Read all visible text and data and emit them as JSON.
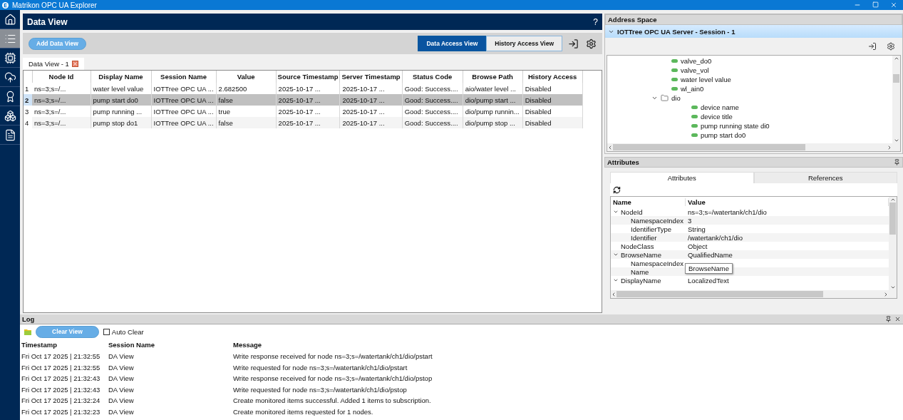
{
  "window": {
    "title": "Matrikon OPC UA Explorer"
  },
  "sidebar": {
    "items": [
      {
        "kind": "home",
        "selected": false
      },
      {
        "kind": "list",
        "selected": true
      },
      {
        "kind": "chip",
        "selected": false
      },
      {
        "kind": "cloud",
        "selected": false
      },
      {
        "kind": "certificate",
        "selected": false
      },
      {
        "kind": "cubes",
        "selected": false
      },
      {
        "kind": "document",
        "selected": false
      }
    ]
  },
  "data_view": {
    "title": "Data View",
    "help": "?",
    "add_button": "Add Data View",
    "view_tabs": [
      {
        "label": "Data Access View",
        "selected": true
      },
      {
        "label": "History Access View",
        "selected": false
      }
    ],
    "document_tabs": [
      {
        "label": "Data View - 1",
        "selected": true
      }
    ],
    "table": {
      "columns": [
        "Node Id",
        "Display Name",
        "Session Name",
        "Value",
        "Source Timestamp",
        "Server Timestamp",
        "Status Code",
        "Browse Path",
        "History Access"
      ],
      "rows": [
        {
          "number": "1",
          "selected": false,
          "cells": [
            "ns=3;s=/...",
            "water level value",
            "IOTTree OPC UA ...",
            "2.682500",
            "2025-10-17 ...",
            "2025-10-17 ...",
            "Good: Success....",
            "aio/water level ...",
            "Disabled"
          ]
        },
        {
          "number": "2",
          "selected": true,
          "cells": [
            "ns=3;s=/...",
            "pump start do0",
            "IOTTree OPC UA ...",
            "false",
            "2025-10-17 ...",
            "2025-10-17 ...",
            "Good: Success....",
            "dio/pump start ...",
            "Disabled"
          ]
        },
        {
          "number": "3",
          "selected": false,
          "cells": [
            "ns=3;s=/...",
            "pump running ...",
            "IOTTree OPC UA ...",
            "true",
            "2025-10-17 ...",
            "2025-10-17 ...",
            "Good: Success....",
            "dio/pump runnin...",
            "Disabled"
          ]
        },
        {
          "number": "4",
          "selected": false,
          "cells": [
            "ns=3;s=/...",
            "pump stop do1",
            "IOTTree OPC UA ...",
            "false",
            "2025-10-17 ...",
            "2025-10-17 ...",
            "Good: Success....",
            "dio/pump stop ...",
            "Disabled"
          ]
        }
      ]
    }
  },
  "address_space": {
    "title": "Address Space",
    "session": {
      "label": "IOTTree OPC UA Server - Session - 1",
      "expanded": true
    },
    "tree": [
      {
        "label": "valve_do0",
        "kind": "variable"
      },
      {
        "label": "valve_vol",
        "kind": "variable"
      },
      {
        "label": "water level value",
        "kind": "variable"
      },
      {
        "label": "wl_ain0",
        "kind": "variable"
      },
      {
        "label": "dio",
        "kind": "folder",
        "expanded": true,
        "children": [
          {
            "label": "device name",
            "kind": "variable"
          },
          {
            "label": "device title",
            "kind": "variable"
          },
          {
            "label": "pump running state di0",
            "kind": "variable"
          },
          {
            "label": "pump start do0",
            "kind": "variable"
          }
        ]
      }
    ]
  },
  "attributes": {
    "title": "Attributes",
    "tabs": [
      {
        "label": "Attributes",
        "selected": true
      },
      {
        "label": "References",
        "selected": false
      }
    ],
    "columns": [
      "Name",
      "Value"
    ],
    "rows": [
      {
        "name": "NodeId",
        "value": "ns=3;s=/watertank/ch1/dio",
        "expanded": true,
        "children": [
          {
            "name": "NamespaceIndex",
            "value": "3"
          },
          {
            "name": "IdentifierType",
            "value": "String"
          },
          {
            "name": "Identifier",
            "value": "/watertank/ch1/dio"
          }
        ]
      },
      {
        "name": "NodeClass",
        "value": "Object"
      },
      {
        "name": "BrowseName",
        "value": "QualifiedName",
        "expanded": true,
        "children": [
          {
            "name": "NamespaceIndex"
          },
          {
            "name": "Name"
          }
        ]
      },
      {
        "name": "DisplayName",
        "value": "LocalizedText",
        "expanded": true
      }
    ],
    "tooltip": "BrowseName"
  },
  "log": {
    "title": "Log",
    "clear_button": "Clear View",
    "auto_clear": {
      "label": "Auto Clear",
      "checked": false
    },
    "columns": [
      "Timestamp",
      "Session Name",
      "Message"
    ],
    "rows": [
      {
        "timestamp": "Fri Oct 17 2025 | 21:32:55",
        "session": "DA View",
        "message": "Write response received for node ns=3;s=/watertank/ch1/dio/pstart"
      },
      {
        "timestamp": "Fri Oct 17 2025 | 21:32:55",
        "session": "DA View",
        "message": "Write requested for node ns=3;s=/watertank/ch1/dio/pstart"
      },
      {
        "timestamp": "Fri Oct 17 2025 | 21:32:43",
        "session": "DA View",
        "message": "Write response received for node ns=3;s=/watertank/ch1/dio/pstop"
      },
      {
        "timestamp": "Fri Oct 17 2025 | 21:32:43",
        "session": "DA View",
        "message": "Write requested for node ns=3;s=/watertank/ch1/dio/pstop"
      },
      {
        "timestamp": "Fri Oct 17 2025 | 21:32:24",
        "session": "DA View",
        "message": "Create monitored items successful. Added 1 items to subscription."
      },
      {
        "timestamp": "Fri Oct 17 2025 | 21:32:23",
        "session": "DA View",
        "message": "Create monitored items requested for 1 nodes."
      }
    ]
  }
}
